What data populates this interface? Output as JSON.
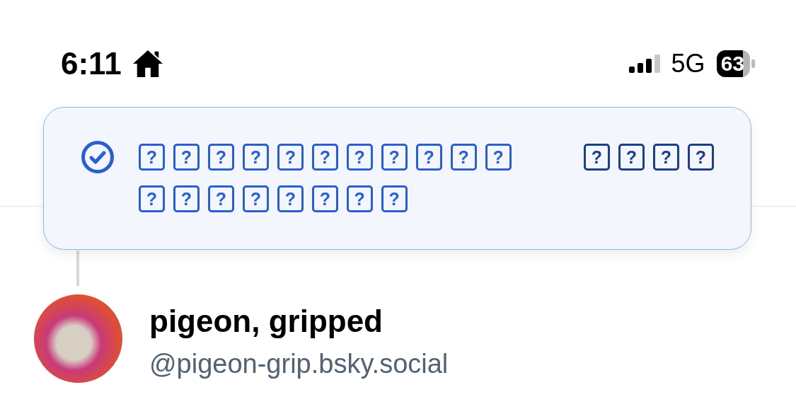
{
  "status_bar": {
    "time": "6:11",
    "network": "5G",
    "battery": "63"
  },
  "toast": {
    "message": "? ? ? ? ? ? ? ? ? ? ? ? ? ? ? ? ? ? ?",
    "action": "? ? ? ?"
  },
  "profile": {
    "name": "pigeon, gripped",
    "handle": "@pigeon-grip.bsky.social"
  }
}
